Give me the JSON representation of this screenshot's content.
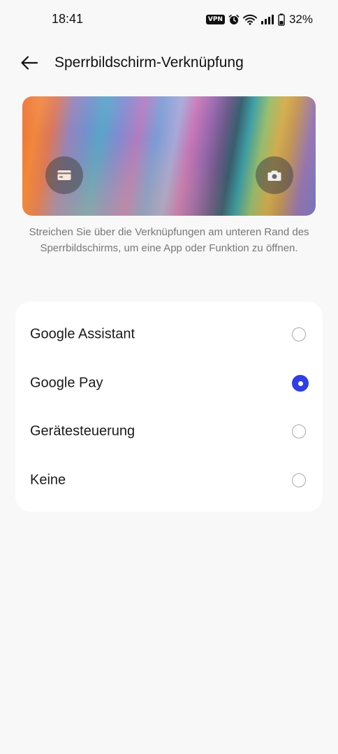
{
  "status_bar": {
    "time": "18:41",
    "vpn_label": "VPN",
    "battery_percent": "32%",
    "icons": [
      "vpn-icon",
      "alarm-icon",
      "wifi-icon",
      "signal-icon",
      "battery-icon"
    ]
  },
  "app_bar": {
    "title": "Sperrbildschirm-Verknüpfung",
    "back_icon": "arrow-left-icon"
  },
  "preview": {
    "left_shortcut_icon": "wallet-card-icon",
    "right_shortcut_icon": "camera-icon"
  },
  "description": "Streichen Sie über die Verknüpfungen am unteren Rand des Sperrbildschirms, um eine App oder Funktion zu öffnen.",
  "options": [
    {
      "label": "Google Assistant",
      "selected": false
    },
    {
      "label": "Google Pay",
      "selected": true
    },
    {
      "label": "Gerätesteuerung",
      "selected": false
    },
    {
      "label": "Keine",
      "selected": false
    }
  ],
  "colors": {
    "accent": "#2f3fe0",
    "background": "#f8f8f8",
    "card": "#ffffff"
  }
}
